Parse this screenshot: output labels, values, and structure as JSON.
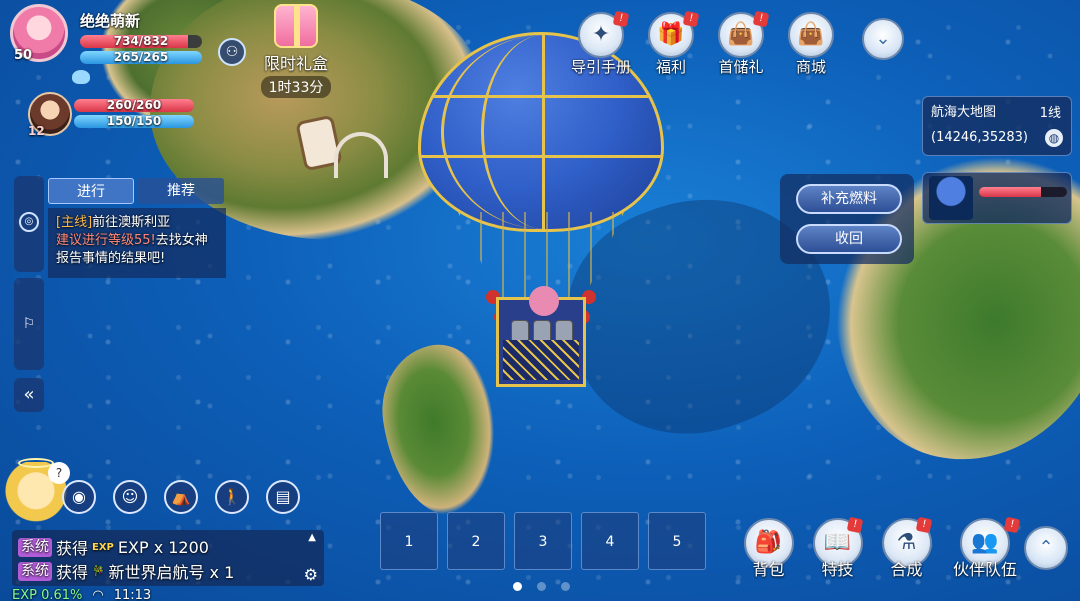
{
  "player": {
    "name": "绝绝萌新",
    "level": "50",
    "hp_text": "734/832",
    "mp_text": "265/265",
    "hp_fraction": 0.882,
    "mp_fraction": 1.0
  },
  "partner": {
    "level": "12",
    "hp_text": "260/260",
    "mp_text": "150/150",
    "hp_fraction": 1.0,
    "mp_fraction": 1.0
  },
  "gift": {
    "label": "限时礼盒",
    "timer": "1时33分"
  },
  "top_menu": [
    {
      "label": "导引手册",
      "icon": "compass-icon",
      "glyph": "✦",
      "badge": "!"
    },
    {
      "label": "福利",
      "icon": "gift-icon",
      "glyph": "🎁",
      "badge": "!"
    },
    {
      "label": "首储礼",
      "icon": "shopping-bag-icon",
      "glyph": "👜",
      "badge": "!"
    },
    {
      "label": "商城",
      "icon": "shopping-bag-icon",
      "glyph": "👜",
      "badge": ""
    }
  ],
  "collapse_glyph": "⌄",
  "map": {
    "name": "航海大地图",
    "line": "1线",
    "coords": "(14246,35283)"
  },
  "vehicle": {
    "fuel_fraction": 0.7
  },
  "fuel_panel": {
    "refuel_label": "补充燃料",
    "recall_label": "收回"
  },
  "quest": {
    "tab_active": "进行",
    "tab_other": "推荐",
    "type": "[主线]",
    "title": "前往澳斯利亚",
    "desc_red": "建议进行等级55!",
    "desc": "去找女神报告事情的结果吧!"
  },
  "side_buttons": {
    "flag_glyph": "⚐",
    "collapse_glyph": "«"
  },
  "chat": {
    "lines": [
      {
        "tag": "系统",
        "prefix": "获得",
        "icon": "EXP",
        "text": "EXP x 1200"
      },
      {
        "tag": "系统",
        "prefix": "获得",
        "icon": "🎋",
        "text": "新世界启航号 x 1"
      }
    ]
  },
  "status": {
    "exp": "EXP 0.61%",
    "time": "11:13"
  },
  "slots": [
    "1",
    "2",
    "3",
    "4",
    "5"
  ],
  "bottom_menu": [
    {
      "label": "背包",
      "icon": "backpack-icon",
      "glyph": "🎒",
      "badge": ""
    },
    {
      "label": "特技",
      "icon": "book-icon",
      "glyph": "📖",
      "badge": "!"
    },
    {
      "label": "合成",
      "icon": "synthesis-icon",
      "glyph": "⚗",
      "badge": "!"
    },
    {
      "label": "伙伴队伍",
      "icon": "party-icon",
      "glyph": "👥",
      "badge": "!"
    }
  ],
  "colors": {
    "hp": "#d83648",
    "mp": "#2a96e0",
    "quest_type": "#ffb84a",
    "chat_tag": "#b05cd6"
  }
}
